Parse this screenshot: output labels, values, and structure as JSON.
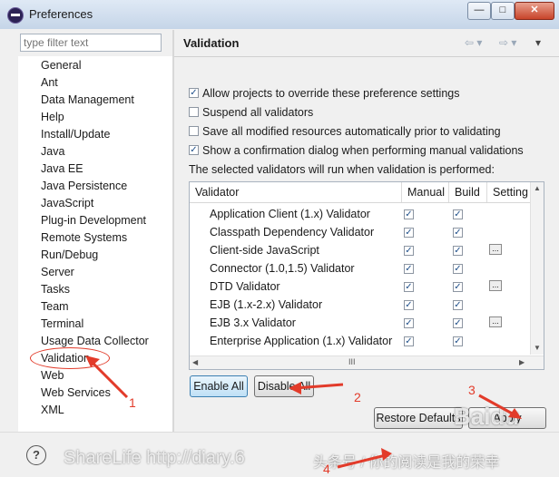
{
  "window": {
    "title": "Preferences",
    "controls": [
      "—",
      "□",
      "✕"
    ]
  },
  "sidebar": {
    "filter_placeholder": "type filter text",
    "items": [
      "General",
      "Ant",
      "Data Management",
      "Help",
      "Install/Update",
      "Java",
      "Java EE",
      "Java Persistence",
      "JavaScript",
      "Plug-in Development",
      "Remote Systems",
      "Run/Debug",
      "Server",
      "Tasks",
      "Team",
      "Terminal",
      "Usage Data Collector",
      "Validation",
      "Web",
      "Web Services",
      "XML"
    ],
    "selected": "Validation"
  },
  "page": {
    "title": "Validation",
    "options": [
      {
        "label": "Allow projects to override these preference settings",
        "checked": true
      },
      {
        "label": "Suspend all validators",
        "checked": false
      },
      {
        "label": "Save all modified resources automatically prior to validating",
        "checked": false
      },
      {
        "label": "Show a confirmation dialog when performing manual validations",
        "checked": true
      }
    ],
    "intro": "The selected validators will run when validation is performed:",
    "table": {
      "columns": [
        "Validator",
        "Manual",
        "Build",
        "Setting"
      ],
      "rows": [
        {
          "name": "Application Client (1.x) Validator",
          "manual": true,
          "build": true,
          "settings": false
        },
        {
          "name": "Classpath Dependency Validator",
          "manual": true,
          "build": true,
          "settings": false
        },
        {
          "name": "Client-side JavaScript",
          "manual": true,
          "build": true,
          "settings": true
        },
        {
          "name": "Connector (1.0,1.5) Validator",
          "manual": true,
          "build": true,
          "settings": false
        },
        {
          "name": "DTD Validator",
          "manual": true,
          "build": true,
          "settings": true
        },
        {
          "name": "EJB (1.x-2.x) Validator",
          "manual": true,
          "build": true,
          "settings": false
        },
        {
          "name": "EJB 3.x Validator",
          "manual": true,
          "build": true,
          "settings": true
        },
        {
          "name": "Enterprise Application (1.x) Validator",
          "manual": true,
          "build": true,
          "settings": false
        }
      ],
      "hscroll_grip": "III"
    },
    "buttons": {
      "enable_all": "Enable All",
      "disable_all": "Disable All",
      "restore_defaults": "Restore Defaults",
      "apply": "Apply"
    }
  },
  "footer": {
    "help_label": "?"
  },
  "overlay": {
    "watermark_left": "ShareLife   http://diary.6",
    "watermark_right": "头条号 / 你的阅读是我的荣幸",
    "baidu": "Baidu",
    "annotations": [
      "1",
      "2",
      "3",
      "4"
    ]
  },
  "colors": {
    "annotation": "#e23b2a",
    "accent": "#3c7fb1"
  }
}
